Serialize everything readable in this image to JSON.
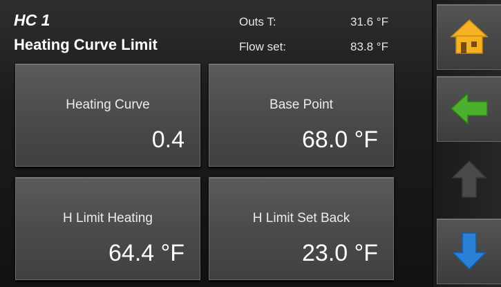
{
  "header": {
    "circuit": "HC 1",
    "title": "Heating Curve Limit",
    "outside_temp_label": "Outs T:",
    "outside_temp_value": "31.6 °F",
    "flow_set_label": "Flow set:",
    "flow_set_value": "83.8 °F"
  },
  "tiles": [
    {
      "label": "Heating Curve",
      "value": "0.4"
    },
    {
      "label": "Base Point",
      "value": "68.0 °F"
    },
    {
      "label": "H Limit Heating",
      "value": "64.4 °F"
    },
    {
      "label": "H Limit Set Back",
      "value": "23.0 °F"
    }
  ],
  "nav": {
    "home_icon": "home-icon",
    "back_icon": "arrow-left-icon",
    "up_icon": "arrow-up-icon",
    "down_icon": "arrow-down-icon",
    "up_state": "disabled"
  },
  "colors": {
    "home": "#f5b324",
    "back": "#4caf2e",
    "up_disabled": "#4a4a4a",
    "down": "#2a7fd6"
  }
}
